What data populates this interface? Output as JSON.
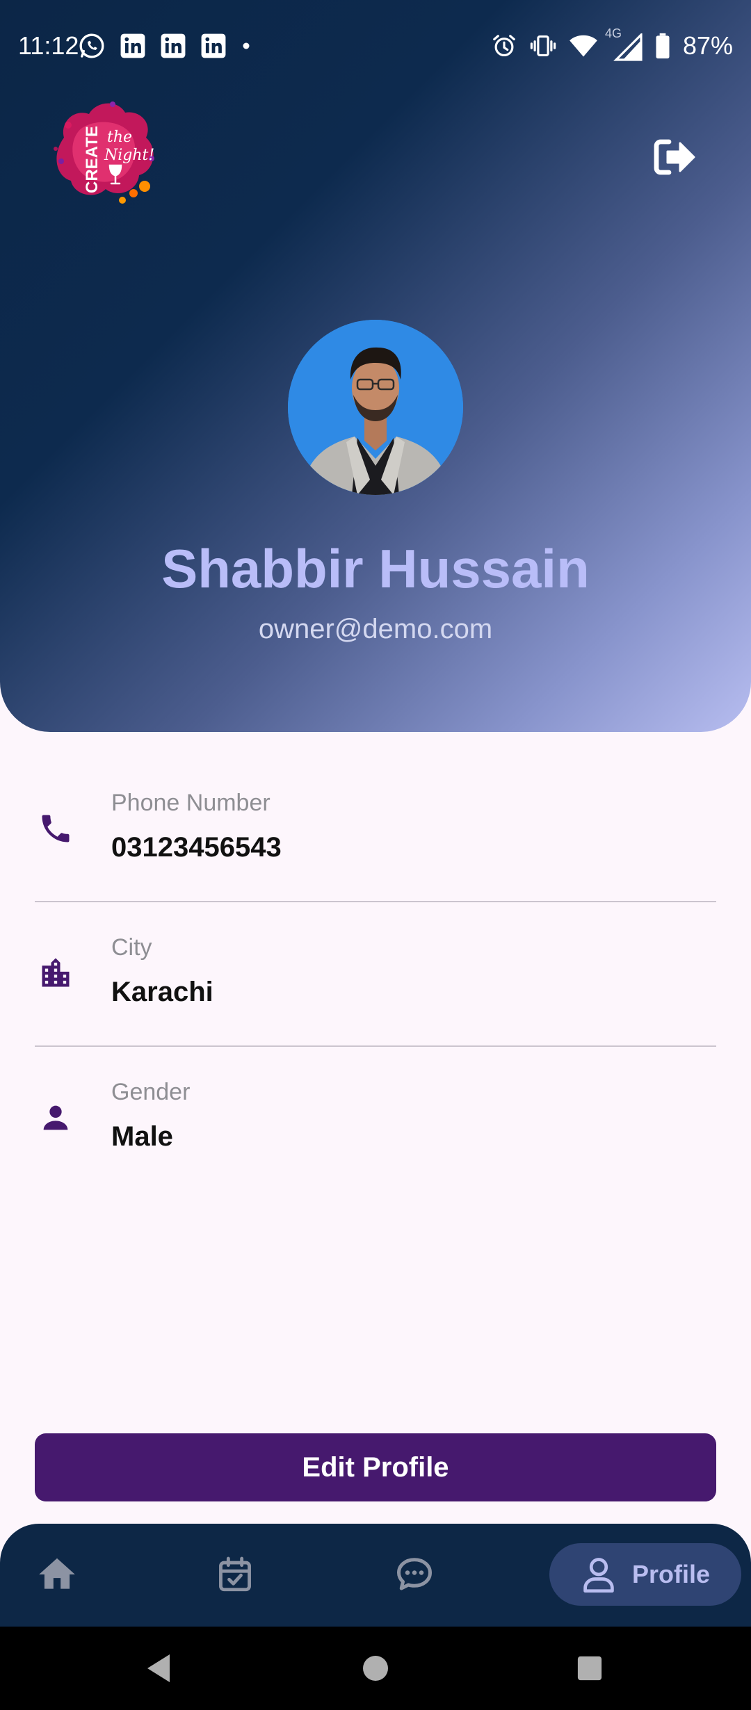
{
  "status_bar": {
    "time": "11:12",
    "battery": "87%",
    "network": "4G",
    "icons": [
      "whatsapp-icon",
      "linkedin-icon",
      "linkedin-icon",
      "linkedin-icon",
      "dot-icon",
      "alarm-icon",
      "vibrate-icon",
      "wifi-icon",
      "signal-icon",
      "battery-icon"
    ]
  },
  "header": {
    "logo_text": {
      "line1": "CREATE",
      "line2": "the",
      "line3": "Night!"
    },
    "logout_icon": "logout-icon"
  },
  "profile": {
    "name": "Shabbir Hussain",
    "email": "owner@demo.com"
  },
  "info": {
    "phone": {
      "label": "Phone Number",
      "value": "03123456543",
      "icon": "phone-icon"
    },
    "city": {
      "label": "City",
      "value": "Karachi",
      "icon": "building-icon"
    },
    "gender": {
      "label": "Gender",
      "value": "Male",
      "icon": "person-icon"
    }
  },
  "actions": {
    "edit_label": "Edit Profile"
  },
  "bottom_nav": {
    "items": [
      {
        "name": "home",
        "icon": "home-icon"
      },
      {
        "name": "events",
        "icon": "calendar-check-icon"
      },
      {
        "name": "chat",
        "icon": "chat-icon"
      },
      {
        "name": "profile",
        "icon": "user-icon",
        "label": "Profile",
        "active": true
      }
    ]
  },
  "colors": {
    "primary": "#46196e",
    "header_dark": "#0c2647",
    "header_light": "#b7bdf0",
    "name_text": "#b9bdf8",
    "nav_bg": "#0d2746",
    "nav_active_bg": "#2f4473",
    "page_bg": "#fdf6fc"
  }
}
